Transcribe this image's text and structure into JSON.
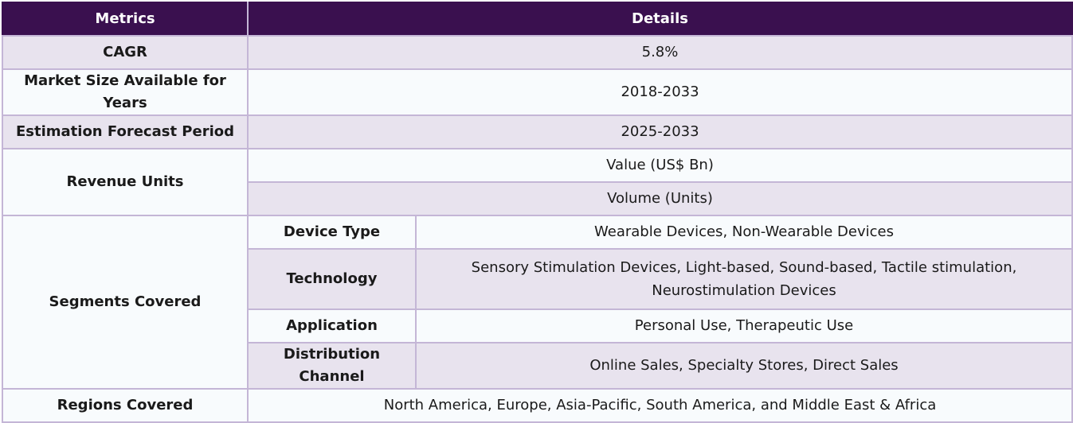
{
  "header": {
    "metrics": "Metrics",
    "details": "Details"
  },
  "rows": {
    "cagr": {
      "label": "CAGR",
      "value": "5.8%"
    },
    "market_size": {
      "label": "Market Size Available for Years",
      "value": "2018-2033"
    },
    "forecast": {
      "label": "Estimation Forecast Period",
      "value": "2025-2033"
    },
    "revenue": {
      "label": "Revenue Units",
      "value1": "Value (US$ Bn)",
      "value2": "Volume (Units)"
    },
    "segments": {
      "label": "Segments Covered",
      "items": [
        {
          "name": "Device Type",
          "value": "Wearable Devices, Non-Wearable Devices"
        },
        {
          "name": "Technology",
          "value": "Sensory Stimulation Devices, Light-based, Sound-based, Tactile stimulation, Neurostimulation Devices"
        },
        {
          "name": "Application",
          "value": "Personal Use, Therapeutic Use"
        },
        {
          "name": "Distribution Channel",
          "value": "Online Sales, Specialty Stores, Direct Sales"
        }
      ]
    },
    "regions": {
      "label": "Regions Covered",
      "value": "North America, Europe, Asia-Pacific, South America, and Middle East & Africa"
    }
  },
  "colors": {
    "header_bg": "#3a104f",
    "shaded_row": "#e8e3ee",
    "plain_row": "#f8fbfd",
    "border": "#c4b6d6"
  }
}
